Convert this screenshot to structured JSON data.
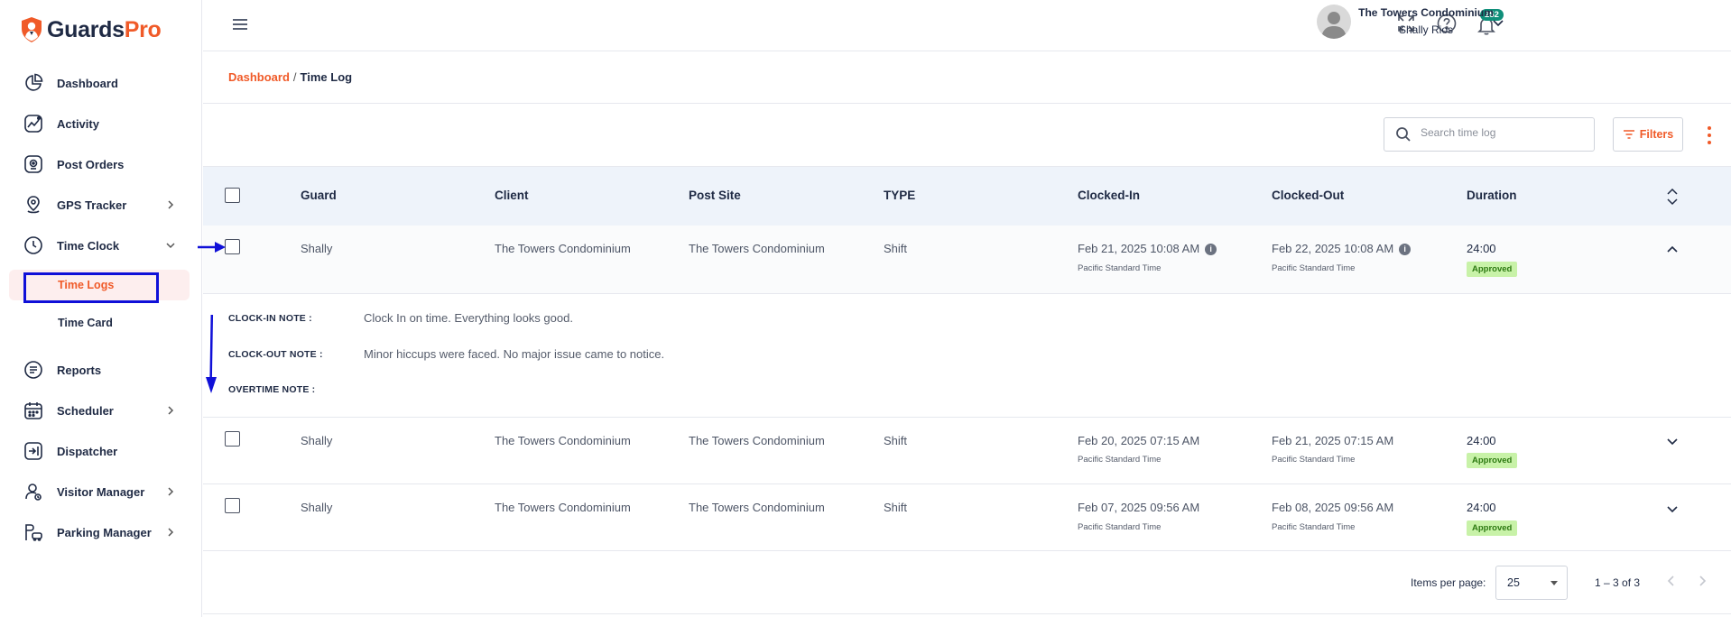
{
  "brand": {
    "part1": "Guards",
    "part2": "Pro",
    "accent": "#f05a28",
    "dark": "#1f2a44"
  },
  "sidebar": {
    "items": [
      {
        "label": "Dashboard",
        "icon": "pie-chart-icon"
      },
      {
        "label": "Activity",
        "icon": "activity-icon"
      },
      {
        "label": "Post Orders",
        "icon": "post-orders-icon"
      },
      {
        "label": "GPS Tracker",
        "icon": "map-pin-icon"
      },
      {
        "label": "Time Clock",
        "icon": "clock-icon"
      },
      {
        "label": "Reports",
        "icon": "report-icon"
      },
      {
        "label": "Scheduler",
        "icon": "calendar-icon"
      },
      {
        "label": "Dispatcher",
        "icon": "dispatcher-icon"
      },
      {
        "label": "Visitor Manager",
        "icon": "visitor-icon"
      },
      {
        "label": "Parking Manager",
        "icon": "parking-icon"
      }
    ],
    "sub_items": [
      {
        "label": "Time Logs"
      },
      {
        "label": "Time Card"
      }
    ]
  },
  "header": {
    "notification_count": "252",
    "user_org": "The Towers Condominium",
    "user_name": "Shally Rios"
  },
  "breadcrumb": {
    "root": "Dashboard",
    "sep": "/",
    "current": "Time Log"
  },
  "toolbar": {
    "search_placeholder": "Search time log",
    "filters_label": "Filters"
  },
  "table": {
    "columns": [
      "Guard",
      "Client",
      "Post Site",
      "TYPE",
      "Clocked-In",
      "Clocked-Out",
      "Duration"
    ],
    "rows": [
      {
        "guard": "Shally",
        "client": "The Towers Condominium",
        "post_site": "The Towers Condominium",
        "type": "Shift",
        "clock_in": "Feb 21, 2025 10:08 AM",
        "clock_in_tz": "Pacific Standard Time",
        "clock_out": "Feb 22, 2025 10:08 AM",
        "clock_out_tz": "Pacific Standard Time",
        "duration": "24:00",
        "status": "Approved",
        "expanded": true
      },
      {
        "guard": "Shally",
        "client": "The Towers Condominium",
        "post_site": "The Towers Condominium",
        "type": "Shift",
        "clock_in": "Feb 20, 2025 07:15 AM",
        "clock_in_tz": "Pacific Standard Time",
        "clock_out": "Feb 21, 2025 07:15 AM",
        "clock_out_tz": "Pacific Standard Time",
        "duration": "24:00",
        "status": "Approved",
        "expanded": false
      },
      {
        "guard": "Shally",
        "client": "The Towers Condominium",
        "post_site": "The Towers Condominium",
        "type": "Shift",
        "clock_in": "Feb 07, 2025 09:56 AM",
        "clock_in_tz": "Pacific Standard Time",
        "clock_out": "Feb 08, 2025 09:56 AM",
        "clock_out_tz": "Pacific Standard Time",
        "duration": "24:00",
        "status": "Approved",
        "expanded": false
      }
    ],
    "notes": {
      "clock_in_label": "CLOCK-IN NOTE :",
      "clock_in_text": "Clock In on time. Everything looks good.",
      "clock_out_label": "CLOCK-OUT NOTE :",
      "clock_out_text": "Minor hiccups were faced. No major issue came to notice.",
      "overtime_label": "OVERTIME NOTE :",
      "overtime_text": ""
    }
  },
  "pagination": {
    "items_per_page_label": "Items per page:",
    "items_per_page": "25",
    "range": "1 – 3 of 3"
  },
  "annotation_color": "#1010d8"
}
